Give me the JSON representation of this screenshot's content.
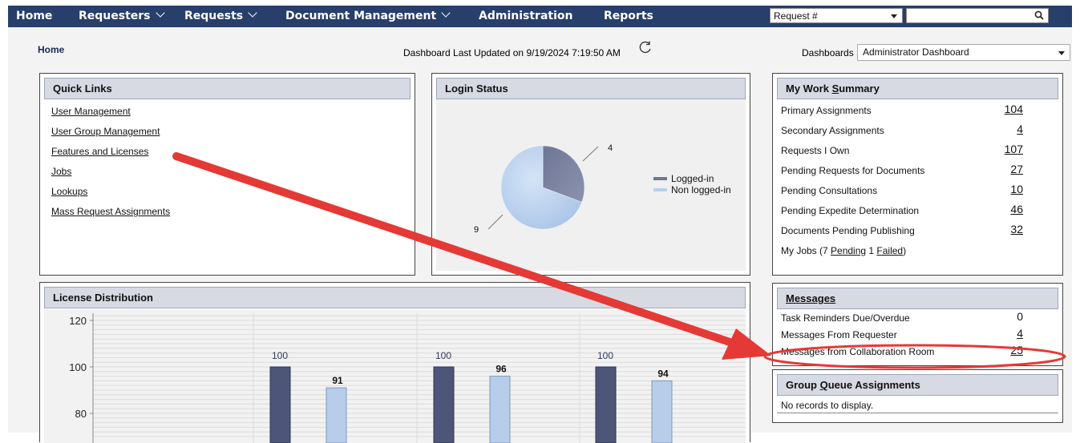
{
  "nav": {
    "home": "Home",
    "requesters": "Requesters",
    "requests": "Requests",
    "document_management": "Document Management",
    "administration": "Administration",
    "reports": "Reports",
    "search_select": "Request #",
    "search_value": "",
    "nav_color": "#283e6b"
  },
  "breadcrumb": "Home",
  "dashboard_updated": "Dashboard Last Updated on 9/19/2024 7:19:50 AM",
  "dashboards": {
    "label": "Dashboards",
    "selected": "Administrator Dashboard"
  },
  "quick_links": {
    "title": "Quick Links",
    "items": [
      "User Management",
      "User Group Management",
      "Features and Licenses",
      "Jobs",
      "Lookups",
      "Mass Request Assignments"
    ]
  },
  "login_status": {
    "title": "Login Status",
    "legend_logged_in": "Logged-in",
    "legend_not_logged_in": "Non logged-in",
    "label_logged_in": "4",
    "label_not_logged_in": "9"
  },
  "work_summary": {
    "title": "My Work Summary",
    "items": [
      {
        "label": "Primary Assignments",
        "value": "104"
      },
      {
        "label": "Secondary Assignments",
        "value": "4"
      },
      {
        "label": "Requests I Own",
        "value": "107"
      },
      {
        "label": "Pending Requests for Documents",
        "value": "27"
      },
      {
        "label": "Pending Consultations",
        "value": "10"
      },
      {
        "label": "Pending Expedite Determination",
        "value": "46"
      },
      {
        "label": "Documents Pending Publishing",
        "value": "32"
      }
    ],
    "jobs_prefix": "My Jobs (7 ",
    "jobs_pending": "Pending",
    "jobs_mid": " 1 ",
    "jobs_failed": "Failed",
    "jobs_suffix": ")"
  },
  "messages": {
    "title": "Messages",
    "items": [
      {
        "label": "Task Reminders Due/Overdue",
        "value": "0"
      },
      {
        "label": "Messages From Requester",
        "value": "4"
      },
      {
        "label": "Messages from Collaboration Room",
        "value": "25"
      }
    ]
  },
  "group_queue": {
    "title": "Group Queue Assignments",
    "empty": "No records to display."
  },
  "license_distribution": {
    "title": "License Distribution"
  },
  "annotation_color": "#e53935",
  "chart_data": [
    {
      "type": "pie",
      "title": "Login Status",
      "series": [
        {
          "name": "Logged-in",
          "values": [
            4
          ]
        },
        {
          "name": "Non logged-in",
          "values": [
            9
          ]
        }
      ],
      "legend": "right"
    },
    {
      "type": "bar",
      "title": "License Distribution",
      "yticks": [
        80,
        100,
        120
      ],
      "ylim": [
        68,
        125
      ],
      "groups": [
        {
          "values": [
            100,
            91
          ],
          "labels": [
            "100",
            "91"
          ]
        },
        {
          "values": [
            100,
            96
          ],
          "labels": [
            "100",
            "96"
          ]
        },
        {
          "values": [
            100,
            94
          ],
          "labels": [
            "100",
            "94"
          ]
        }
      ],
      "grid": true
    }
  ]
}
